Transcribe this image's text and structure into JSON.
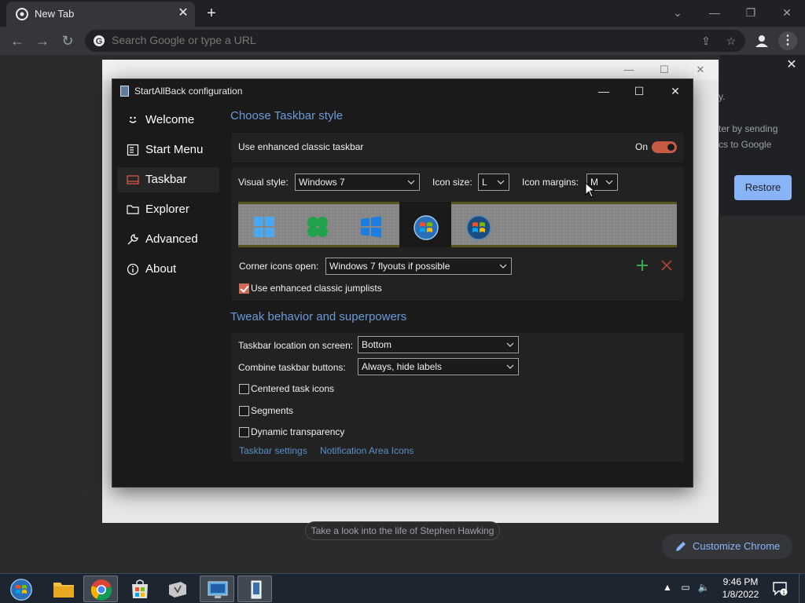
{
  "chrome": {
    "tab_title": "New Tab",
    "omnibox_placeholder": "Search Google or type a URL",
    "restore_text_1": "y.",
    "restore_text_2": "ter by sending",
    "restore_text_3": "cs to Google",
    "restore_button": "Restore",
    "hawking_link": "Take a look into the life of Stephen Hawking",
    "customize_label": "Customize Chrome"
  },
  "sab": {
    "window_title": "StartAllBack configuration",
    "nav": [
      {
        "label": "Welcome",
        "icon": "smile-icon"
      },
      {
        "label": "Start Menu",
        "icon": "start-menu-icon"
      },
      {
        "label": "Taskbar",
        "icon": "taskbar-icon"
      },
      {
        "label": "Explorer",
        "icon": "folder-icon"
      },
      {
        "label": "Advanced",
        "icon": "wrench-icon"
      },
      {
        "label": "About",
        "icon": "info-icon"
      }
    ],
    "active_nav": "Taskbar",
    "section1_title": "Choose Taskbar style",
    "enhanced_taskbar_label": "Use enhanced classic taskbar",
    "enhanced_taskbar_state": "On",
    "visual_style_label": "Visual style:",
    "visual_style_value": "Windows 7",
    "icon_size_label": "Icon size:",
    "icon_size_value": "L",
    "icon_margins_label": "Icon margins:",
    "icon_margins_value": "M",
    "preview_styles": [
      "Windows 11",
      "Windows 10 green",
      "Windows 10",
      "Windows 7",
      "Windows Vista"
    ],
    "selected_preview": "Windows 7",
    "corner_icons_label": "Corner icons open:",
    "corner_icons_value": "Windows 7 flyouts if possible",
    "jumplists_label": "Use enhanced classic jumplists",
    "jumplists_checked": true,
    "section2_title": "Tweak behavior and superpowers",
    "location_label": "Taskbar location on screen:",
    "location_value": "Bottom",
    "combine_label": "Combine taskbar buttons:",
    "combine_value": "Always, hide labels",
    "centered_label": "Centered task icons",
    "centered_checked": false,
    "segments_label": "Segments",
    "segments_checked": false,
    "dynamic_label": "Dynamic transparency",
    "dynamic_checked": false,
    "link_taskbar_settings": "Taskbar settings",
    "link_notification_icons": "Notification Area Icons"
  },
  "taskbar": {
    "apps": [
      "start-orb-icon",
      "file-explorer-icon",
      "chrome-icon",
      "store-icon",
      "mail-icon",
      "remote-desktop-icon",
      "startallback-icon"
    ],
    "time": "9:46 PM",
    "date": "1/8/2022",
    "notification_count": "1"
  },
  "colors": {
    "accent_blue": "#6b9bd6",
    "toggle_on": "#c75a45",
    "checkbox_on": "#d06a55",
    "link_blue": "#5a8fc8",
    "chrome_button": "#8ab4f8"
  }
}
